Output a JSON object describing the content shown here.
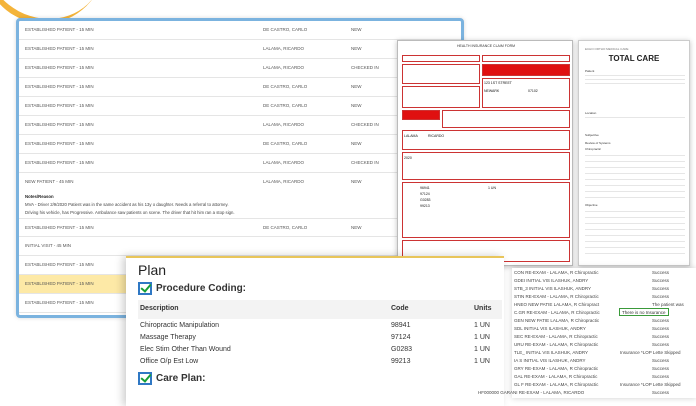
{
  "schedule": {
    "rows": [
      {
        "visit": "ESTABLISHED PATIENT - 15 MIN",
        "provider": "DE CASTRO, CARLO",
        "status": "NEW"
      },
      {
        "visit": "ESTABLISHED PATIENT - 15 MIN",
        "provider": "LALAMA, RICARDO",
        "status": "NEW"
      },
      {
        "visit": "ESTABLISHED PATIENT - 15 MIN",
        "provider": "LALAMA, RICARDO",
        "status": "CHECKED IN"
      },
      {
        "visit": "ESTABLISHED PATIENT - 15 MIN",
        "provider": "DE CASTRO, CARLO",
        "status": "NEW"
      },
      {
        "visit": "ESTABLISHED PATIENT - 15 MIN",
        "provider": "DE CASTRO, CARLO",
        "status": "NEW"
      },
      {
        "visit": "ESTABLISHED PATIENT - 15 MIN",
        "provider": "LALAMA, RICARDO",
        "status": "CHECKED IN"
      },
      {
        "visit": "ESTABLISHED PATIENT - 15 MIN",
        "provider": "DE CASTRO, CARLO",
        "status": "NEW"
      },
      {
        "visit": "ESTABLISHED PATIENT - 15 MIN",
        "provider": "LALAMA, RICARDO",
        "status": "CHECKED IN"
      }
    ],
    "new_patient": {
      "visit": "NEW PATIENT - 45 MIN",
      "provider": "LALAMA, RICARDO",
      "status": "NEW"
    },
    "notes_label": "Notes/Reason",
    "notes_lines": [
      "MVA - Driver 2/9/2020 Patient was in the same accident as his 13y o daughter. Needs a referral to attorney.",
      "Driving his vehicle, has Progressive. Ambulance saw patients on scene. The driver that hit him ran a stop sign."
    ],
    "rows_after": [
      {
        "visit": "ESTABLISHED PATIENT - 15 MIN",
        "provider": "DE CASTRO, CARLO",
        "status": "NEW"
      },
      {
        "visit": "INITIAL VISIT - 45 MIN",
        "provider": "",
        "status": ""
      },
      {
        "visit": "ESTABLISHED PATIENT - 15 MIN",
        "provider": "",
        "status": ""
      },
      {
        "visit": "ESTABLISHED PATIENT - 15 MIN",
        "provider": "",
        "status": ""
      },
      {
        "visit": "ESTABLISHED PATIENT - 15 MIN",
        "provider": "",
        "status": ""
      }
    ]
  },
  "claim_form": {
    "title": "HEALTH INSURANCE CLAIM FORM",
    "lines": [
      "LALAMA",
      "RICARDO",
      "123 1ST STREET",
      "NEWARK",
      "07102",
      "2020",
      "96941",
      "97124",
      "G0283",
      "99213",
      "1 UN"
    ]
  },
  "report": {
    "header": "ECHO ORTHO MEDICAL CARE",
    "title": "TOTAL CARE",
    "labels": [
      "Patient",
      "Location",
      "Subjective",
      "Review of Systems",
      "Chiropractic",
      "Objective"
    ]
  },
  "plan": {
    "title": "Plan",
    "procedure_heading": "Procedure Coding:",
    "columns": {
      "description": "Description",
      "code": "Code",
      "units": "Units"
    },
    "procedures": [
      {
        "description": "Chiropractic Manipulation",
        "code": "98941",
        "units": "1 UN"
      },
      {
        "description": "Massage Therapy",
        "code": "97124",
        "units": "1 UN"
      },
      {
        "description": "Elec Stim Other Than Wound",
        "code": "G0283",
        "units": "1 UN"
      },
      {
        "description": "Office O/p Est Low",
        "code": "99213",
        "units": "1 UN"
      }
    ],
    "care_plan_heading": "Care Plan:"
  },
  "log": {
    "tooltip": "There is no Insurance",
    "rows": [
      {
        "text": "CON RE-EXAM - LALAMA, R Chiropractic",
        "status": "Success"
      },
      {
        "text": "GDEI INITIAL VIS ILASHUK, ANDRY",
        "status": "Success"
      },
      {
        "text": "STB_3 INITIAL VIS ILASHUK, ANDRY",
        "status": "Success"
      },
      {
        "text": "STIN RE-EXAM - LALAMA, R Chiropractic",
        "status": "Success"
      },
      {
        "text": "HNEO NEW PATIE LALAMA, R Chiropract",
        "status": "The patient was"
      },
      {
        "text": "C.GR RE-EXAM - LALAMA, R Chiropractic",
        "status": "Success"
      },
      {
        "text": "GEN NEW PATIE LALAMA, R Chiropractic",
        "status": "Success"
      },
      {
        "text": "SDL INITIAL VIS ILASHUK, ANDRY",
        "status": "Success"
      },
      {
        "text": "SEC RE-EXAM - LALAMA, R Chiropractic",
        "status": "Success"
      },
      {
        "text": "URU RE-EXAM - LALAMA, R Chiropractic",
        "status": "Success"
      },
      {
        "text": "TLE_ INITIAL VIS ILASHUK, ANDRY",
        "status": "Insurance *LOP Lette Skipped"
      },
      {
        "text": "IA S INITIAL VIS ILASHUK, ANDRY",
        "status": "Success"
      },
      {
        "text": "GRY RE-EXAM - LALAMA, R Chiropractic",
        "status": "Success"
      },
      {
        "text": "GAL RE-EXAM - LALAMA, R Chiropractic",
        "status": "Success"
      },
      {
        "text": "GL F RE-EXAM - LALAMA, R Chiropractic",
        "status": "Insurance *LOP Lette Skipped"
      },
      {
        "text": "HF000000 GARANI RE-EXAM - LALAMA, RICARDO",
        "status": "Success"
      }
    ]
  }
}
